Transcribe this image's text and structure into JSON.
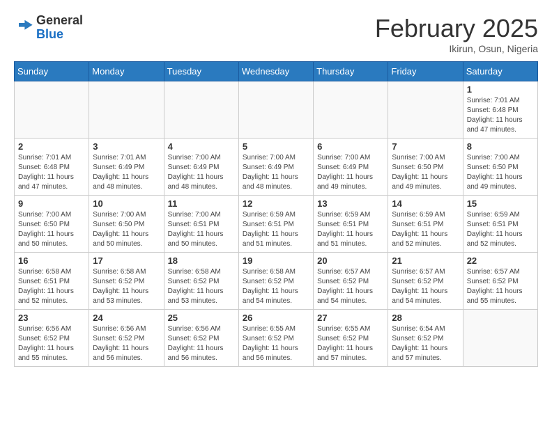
{
  "header": {
    "logo_general": "General",
    "logo_blue": "Blue",
    "month": "February 2025",
    "location": "Ikirun, Osun, Nigeria"
  },
  "days_of_week": [
    "Sunday",
    "Monday",
    "Tuesday",
    "Wednesday",
    "Thursday",
    "Friday",
    "Saturday"
  ],
  "weeks": [
    [
      {
        "day": "",
        "info": ""
      },
      {
        "day": "",
        "info": ""
      },
      {
        "day": "",
        "info": ""
      },
      {
        "day": "",
        "info": ""
      },
      {
        "day": "",
        "info": ""
      },
      {
        "day": "",
        "info": ""
      },
      {
        "day": "1",
        "info": "Sunrise: 7:01 AM\nSunset: 6:48 PM\nDaylight: 11 hours and 47 minutes."
      }
    ],
    [
      {
        "day": "2",
        "info": "Sunrise: 7:01 AM\nSunset: 6:48 PM\nDaylight: 11 hours and 47 minutes."
      },
      {
        "day": "3",
        "info": "Sunrise: 7:01 AM\nSunset: 6:49 PM\nDaylight: 11 hours and 48 minutes."
      },
      {
        "day": "4",
        "info": "Sunrise: 7:00 AM\nSunset: 6:49 PM\nDaylight: 11 hours and 48 minutes."
      },
      {
        "day": "5",
        "info": "Sunrise: 7:00 AM\nSunset: 6:49 PM\nDaylight: 11 hours and 48 minutes."
      },
      {
        "day": "6",
        "info": "Sunrise: 7:00 AM\nSunset: 6:49 PM\nDaylight: 11 hours and 49 minutes."
      },
      {
        "day": "7",
        "info": "Sunrise: 7:00 AM\nSunset: 6:50 PM\nDaylight: 11 hours and 49 minutes."
      },
      {
        "day": "8",
        "info": "Sunrise: 7:00 AM\nSunset: 6:50 PM\nDaylight: 11 hours and 49 minutes."
      }
    ],
    [
      {
        "day": "9",
        "info": "Sunrise: 7:00 AM\nSunset: 6:50 PM\nDaylight: 11 hours and 50 minutes."
      },
      {
        "day": "10",
        "info": "Sunrise: 7:00 AM\nSunset: 6:50 PM\nDaylight: 11 hours and 50 minutes."
      },
      {
        "day": "11",
        "info": "Sunrise: 7:00 AM\nSunset: 6:51 PM\nDaylight: 11 hours and 50 minutes."
      },
      {
        "day": "12",
        "info": "Sunrise: 6:59 AM\nSunset: 6:51 PM\nDaylight: 11 hours and 51 minutes."
      },
      {
        "day": "13",
        "info": "Sunrise: 6:59 AM\nSunset: 6:51 PM\nDaylight: 11 hours and 51 minutes."
      },
      {
        "day": "14",
        "info": "Sunrise: 6:59 AM\nSunset: 6:51 PM\nDaylight: 11 hours and 52 minutes."
      },
      {
        "day": "15",
        "info": "Sunrise: 6:59 AM\nSunset: 6:51 PM\nDaylight: 11 hours and 52 minutes."
      }
    ],
    [
      {
        "day": "16",
        "info": "Sunrise: 6:58 AM\nSunset: 6:51 PM\nDaylight: 11 hours and 52 minutes."
      },
      {
        "day": "17",
        "info": "Sunrise: 6:58 AM\nSunset: 6:52 PM\nDaylight: 11 hours and 53 minutes."
      },
      {
        "day": "18",
        "info": "Sunrise: 6:58 AM\nSunset: 6:52 PM\nDaylight: 11 hours and 53 minutes."
      },
      {
        "day": "19",
        "info": "Sunrise: 6:58 AM\nSunset: 6:52 PM\nDaylight: 11 hours and 54 minutes."
      },
      {
        "day": "20",
        "info": "Sunrise: 6:57 AM\nSunset: 6:52 PM\nDaylight: 11 hours and 54 minutes."
      },
      {
        "day": "21",
        "info": "Sunrise: 6:57 AM\nSunset: 6:52 PM\nDaylight: 11 hours and 54 minutes."
      },
      {
        "day": "22",
        "info": "Sunrise: 6:57 AM\nSunset: 6:52 PM\nDaylight: 11 hours and 55 minutes."
      }
    ],
    [
      {
        "day": "23",
        "info": "Sunrise: 6:56 AM\nSunset: 6:52 PM\nDaylight: 11 hours and 55 minutes."
      },
      {
        "day": "24",
        "info": "Sunrise: 6:56 AM\nSunset: 6:52 PM\nDaylight: 11 hours and 56 minutes."
      },
      {
        "day": "25",
        "info": "Sunrise: 6:56 AM\nSunset: 6:52 PM\nDaylight: 11 hours and 56 minutes."
      },
      {
        "day": "26",
        "info": "Sunrise: 6:55 AM\nSunset: 6:52 PM\nDaylight: 11 hours and 56 minutes."
      },
      {
        "day": "27",
        "info": "Sunrise: 6:55 AM\nSunset: 6:52 PM\nDaylight: 11 hours and 57 minutes."
      },
      {
        "day": "28",
        "info": "Sunrise: 6:54 AM\nSunset: 6:52 PM\nDaylight: 11 hours and 57 minutes."
      },
      {
        "day": "",
        "info": ""
      }
    ]
  ]
}
